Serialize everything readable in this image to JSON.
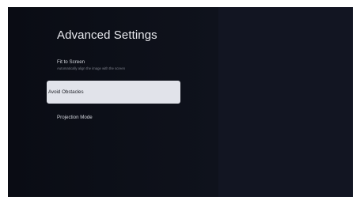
{
  "page": {
    "title": "Advanced Settings"
  },
  "menu": {
    "items": [
      {
        "label": "Fit to Screen",
        "description": "Automatically align the image with the screen",
        "focused": false
      },
      {
        "label": "Avoid Obstacles",
        "focused": true
      },
      {
        "label": "Projection Mode",
        "focused": false
      }
    ]
  },
  "colors": {
    "background": "#0d0f16",
    "right_panel": "#121522",
    "focus_highlight": "#e1e3ea",
    "primary_text": "#d5d7de",
    "secondary_text": "#7d808b"
  }
}
